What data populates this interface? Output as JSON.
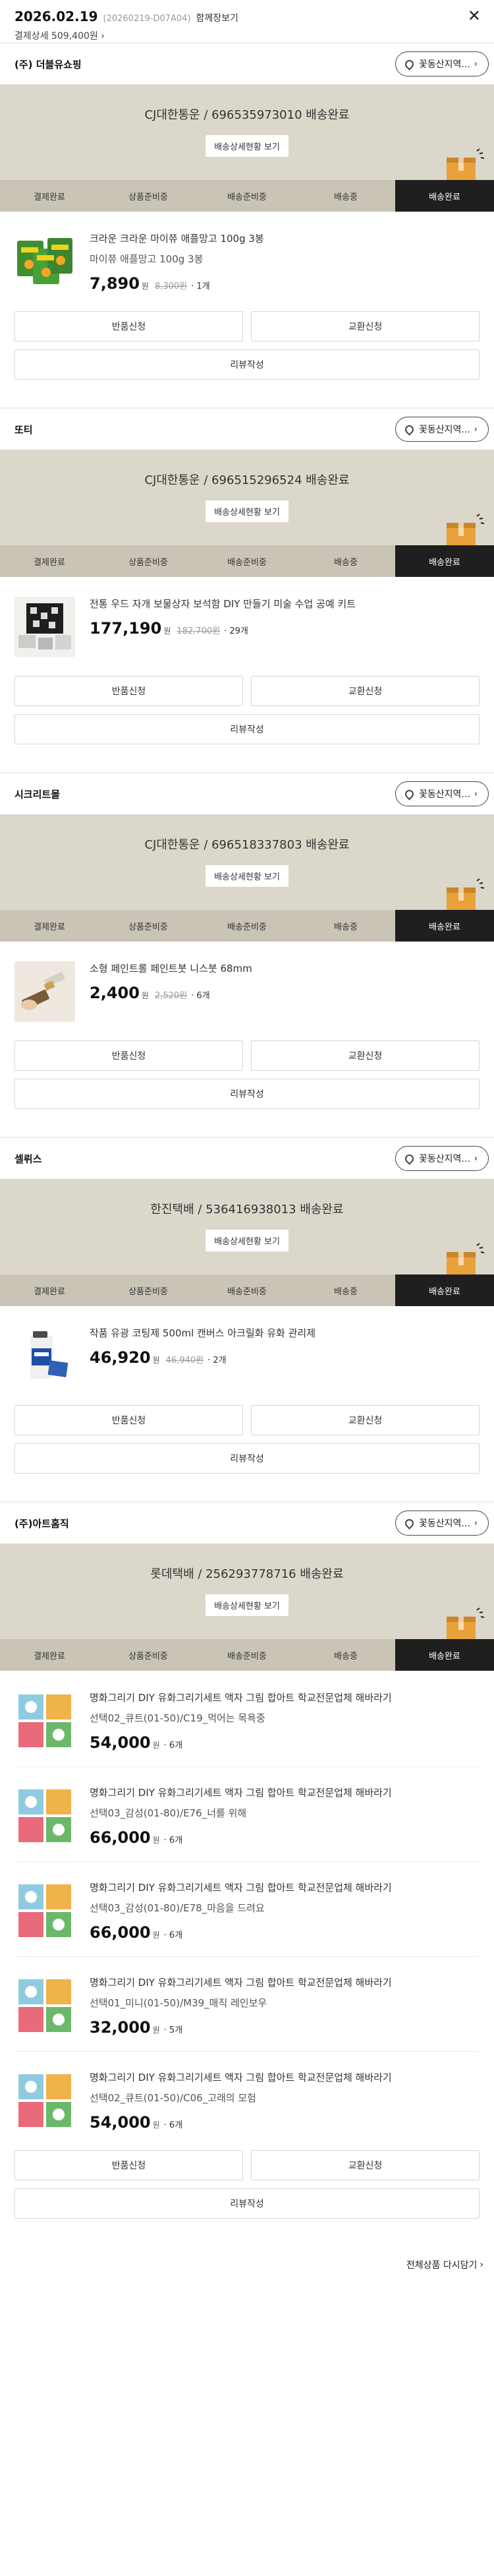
{
  "order": {
    "date": "2026.02.19",
    "order_no": "(20260219-D07A04)",
    "view_all": "함께장보기",
    "total_label": "결제상세",
    "total": "509,400원",
    "close_icon": "close-icon"
  },
  "tracker_steps": [
    "결제완료",
    "상품준비중",
    "배송준비중",
    "배송중",
    "배송완료"
  ],
  "labels": {
    "location_btn": "꽃동산지역...",
    "tracking_btn": "배송상세현황 보기",
    "return": "반품신청",
    "exchange": "교환신청",
    "review": "리뷰작성",
    "won": "원",
    "rebuy": "전체상품 다시담기"
  },
  "stores": [
    {
      "name": "(주) 더블유쇼핑",
      "shipping": "CJ대한통운 / 696535973010 배송완료",
      "items": [
        {
          "name": "크라운 크라운 마이쮸 애플망고 100g 3봉",
          "option": "마이쮸 애플망고 100g 3봉",
          "price": "7,890",
          "original": "8,300원",
          "qty": "1개"
        }
      ]
    },
    {
      "name": "또티",
      "shipping": "CJ대한통운 / 696515296524 배송완료",
      "items": [
        {
          "name": "전통 우드 자개 보물상자 보석함 DIY 만들기 미술 수업 공예 키트",
          "option": "",
          "price": "177,190",
          "original": "182,700원",
          "qty": "29개"
        }
      ]
    },
    {
      "name": "시크리트몰",
      "shipping": "CJ대한통운 / 696518337803 배송완료",
      "items": [
        {
          "name": "소형 페인트롤 페인트붓 니스붓 68mm",
          "option": "",
          "price": "2,400",
          "original": "2,520원",
          "qty": "6개"
        }
      ]
    },
    {
      "name": "셀뤼스",
      "shipping": "한진택배 / 536416938013 배송완료",
      "items": [
        {
          "name": "작품 유광 코팅제 500ml 캔버스 아크릴화 유화 관리제",
          "option": "",
          "price": "46,920",
          "original": "46,940원",
          "qty": "2개"
        }
      ]
    },
    {
      "name": "(주)아트홈직",
      "shipping": "롯데택배 / 256293778716 배송완료",
      "items": [
        {
          "name": "명화그리기 DIY 유화그리기세트 액자 그림 합아트 학교전문업체 해바라기",
          "option": "선택02_큐트(01-50)/C19_먹어는 목욕중",
          "price": "54,000",
          "original": "",
          "qty": "6개"
        },
        {
          "name": "명화그리기 DIY 유화그리기세트 액자 그림 합아트 학교전문업체 해바라기",
          "option": "선택03_감성(01-80)/E76_너를 위해",
          "price": "66,000",
          "original": "",
          "qty": "6개"
        },
        {
          "name": "명화그리기 DIY 유화그리기세트 액자 그림 합아트 학교전문업체 해바라기",
          "option": "선택03_감성(01-80)/E78_마음을 드려요",
          "price": "66,000",
          "original": "",
          "qty": "6개"
        },
        {
          "name": "명화그리기 DIY 유화그리기세트 액자 그림 합아트 학교전문업체 해바라기",
          "option": "선택01_미니(01-50)/M39_매직 레인보우",
          "price": "32,000",
          "original": "",
          "qty": "5개"
        },
        {
          "name": "명화그리기 DIY 유화그리기세트 액자 그림 합아트 학교전문업체 해바라기",
          "option": "선택02_큐트(01-50)/C06_고래의 모험",
          "price": "54,000",
          "original": "",
          "qty": "6개"
        }
      ]
    }
  ]
}
